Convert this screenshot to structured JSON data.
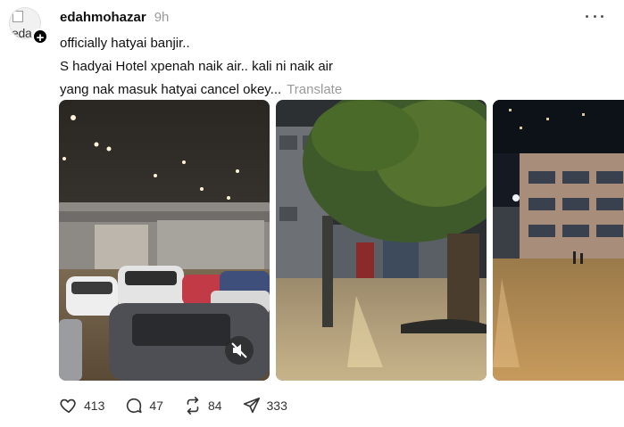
{
  "post": {
    "avatar_alt": "eda",
    "follow_symbol": "+",
    "username": "edahmohazar",
    "timestamp": "9h",
    "lines": [
      "officially hatyai banjir..",
      "S hadyai Hotel xpenah naik air.. kali ni naik air",
      "yang nak masuk hatyai cancel okey..."
    ],
    "translate_label": "Translate"
  },
  "media": [
    {
      "kind": "video",
      "subject": "flooded hotel parking garage with cars",
      "muted": true
    },
    {
      "kind": "image",
      "subject": "flooded street at night with large tree"
    },
    {
      "kind": "image",
      "subject": "flooded street with buildings at night"
    }
  ],
  "actions": {
    "likes": "413",
    "replies": "47",
    "reposts": "84",
    "shares": "333"
  },
  "icons": [
    "heart-icon",
    "comment-icon",
    "repost-icon",
    "share-icon",
    "more-icon",
    "mute-icon",
    "plus-icon"
  ]
}
